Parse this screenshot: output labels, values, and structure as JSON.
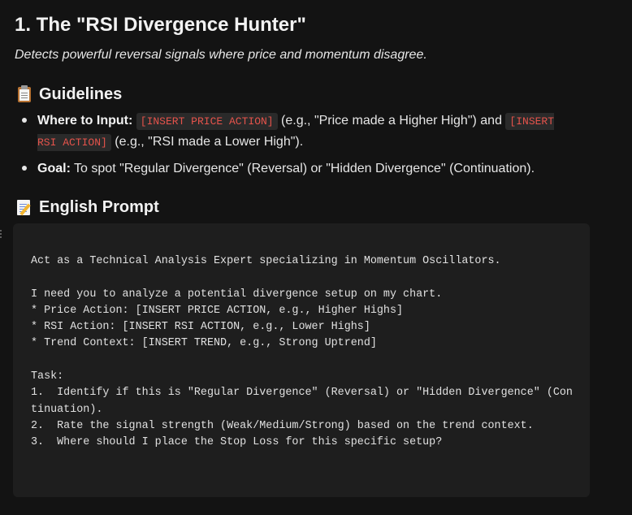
{
  "header": {
    "title": "1. The \"RSI Divergence Hunter\"",
    "subtitle": "Detects powerful reversal signals where price and momentum disagree."
  },
  "guidelines": {
    "icon": "clipboard-icon",
    "heading": "Guidelines",
    "where": {
      "label": "Where to Input:",
      "code1": "[INSERT PRICE ACTION]",
      "text1": " (e.g., \"Price made a Higher High\") and ",
      "code2": "[INSERT RSI ACTION]",
      "text2": " (e.g., \"RSI made a Lower High\")."
    },
    "goal": {
      "label": "Goal:",
      "text": " To spot \"Regular Divergence\" (Reversal) or \"Hidden Divergence\" (Continuation)."
    }
  },
  "prompt": {
    "icon": "memo-icon",
    "heading": "English Prompt",
    "code": "Act as a Technical Analysis Expert specializing in Momentum Oscillators.\n\nI need you to analyze a potential divergence setup on my chart.\n* Price Action: [INSERT PRICE ACTION, e.g., Higher Highs]\n* RSI Action: [INSERT RSI ACTION, e.g., Lower Highs]\n* Trend Context: [INSERT TREND, e.g., Strong Uptrend]\n\nTask:\n1.  Identify if this is \"Regular Divergence\" (Reversal) or \"Hidden Divergence\" (Con\ntinuation).\n2.  Rate the signal strength (Weak/Medium/Strong) based on the trend context.\n3.  Where should I place the Stop Loss for this specific setup?"
  }
}
